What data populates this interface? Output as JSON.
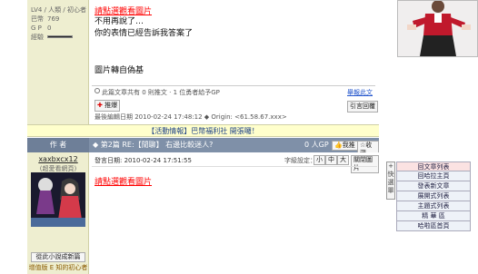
{
  "post1": {
    "level_line": "LV4 / 人類 / 初心者",
    "stats": [
      {
        "label": "巴幣",
        "value": "769"
      },
      {
        "label": "G P",
        "value": "0"
      },
      {
        "label": "經驗",
        "value": ""
      }
    ],
    "title_link": "請點選觀看圖片",
    "lines": [
      "不用再說了…",
      "你的表情已經告訴我答案了"
    ],
    "note": "圖片轉自偽基",
    "share_text": "此篇文章共有 0 則推文 · 1 位勇者給予GP",
    "fav_link": "舉報此文",
    "push_button": "推爆",
    "edit_info": "最後編輯日期 2010-02-24 17:48:12 ◆ Origin: <61.58.67.xxx>",
    "reply_button": "引言回覆"
  },
  "announcement": "【活動情報】巴幣福利社 開張囉！",
  "post2": {
    "author_header": "作 者",
    "floor_label": "◆ 第2篇 RE:【閒聊】 右邊比較迷人?",
    "gp_text": "0 人GP",
    "gp_button": "我推",
    "fav_button": "收藏",
    "username": "xaxbxcx12",
    "nickname": "(超愛看網頁)",
    "quote_button": "從此小說成新篇",
    "title": "增值版 E 知的初心者",
    "date_text": "發言日期: 2010-02-24 17:51:55",
    "font_size_label": "字級設定：",
    "font_sizes": [
      "小",
      "中",
      "大"
    ],
    "hide_image_button": "關閉圖片",
    "title_link": "請點選觀看圖片"
  },
  "quick_menu": {
    "tab_label": "+ 快 選 單",
    "items": [
      "回文章列表",
      "回哈拉主頁",
      "發表新文章",
      "展開式列表",
      "主題式列表",
      "精 華 區",
      "哈啦區首頁"
    ]
  }
}
